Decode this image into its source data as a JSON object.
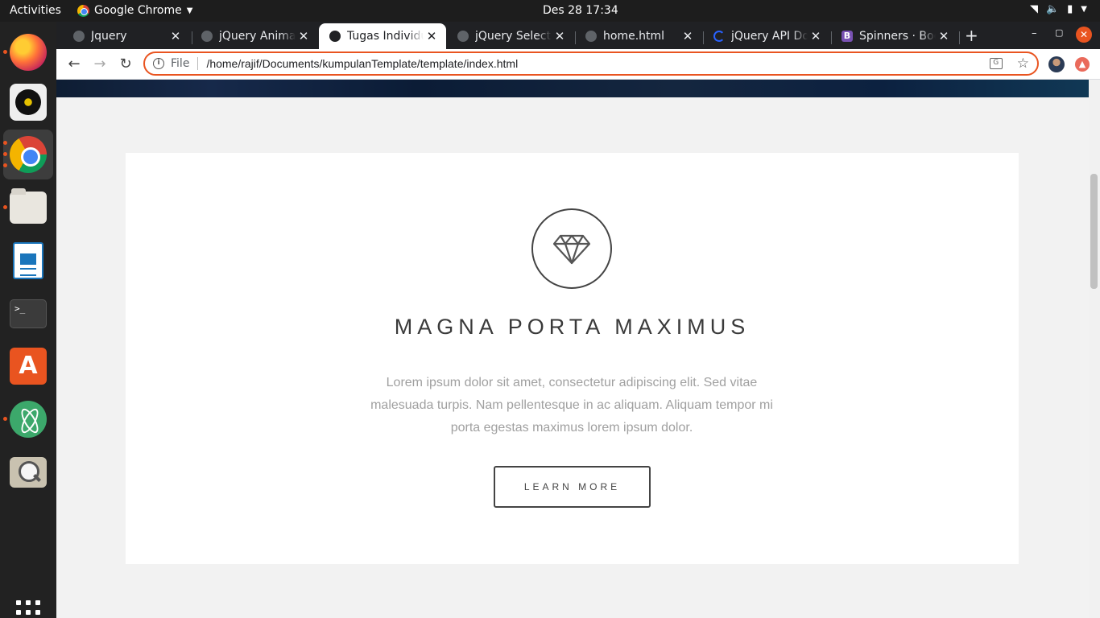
{
  "system": {
    "activities": "Activities",
    "app_name": "Google Chrome",
    "clock": "Des 28  17:34"
  },
  "browser": {
    "tabs": [
      {
        "title": "Jquery",
        "active": false
      },
      {
        "title": "jQuery Animation",
        "active": false
      },
      {
        "title": "Tugas Individu",
        "active": true
      },
      {
        "title": "jQuery Selectors",
        "active": false
      },
      {
        "title": "home.html",
        "active": false
      },
      {
        "title": "jQuery API Docs",
        "active": false
      },
      {
        "title": "Spinners · Bootstrap",
        "active": false
      }
    ],
    "omnibox": {
      "scheme_label": "File",
      "url": "/home/rajif/Documents/kumpulanTemplate/template/index.html"
    }
  },
  "page": {
    "card": {
      "icon": "diamond-icon",
      "title": "MAGNA PORTA MAXIMUS",
      "text": "Lorem ipsum dolor sit amet, consectetur adipiscing elit. Sed vitae malesuada turpis. Nam pellentesque in ac aliquam. Aliquam tempor mi porta egestas maximus lorem ipsum dolor.",
      "button": "LEARN MORE"
    }
  },
  "colors": {
    "ubuntu_orange": "#e95420",
    "dock_bg": "#222222",
    "card_bg": "#ffffff",
    "page_bg": "#f2f2f2"
  }
}
